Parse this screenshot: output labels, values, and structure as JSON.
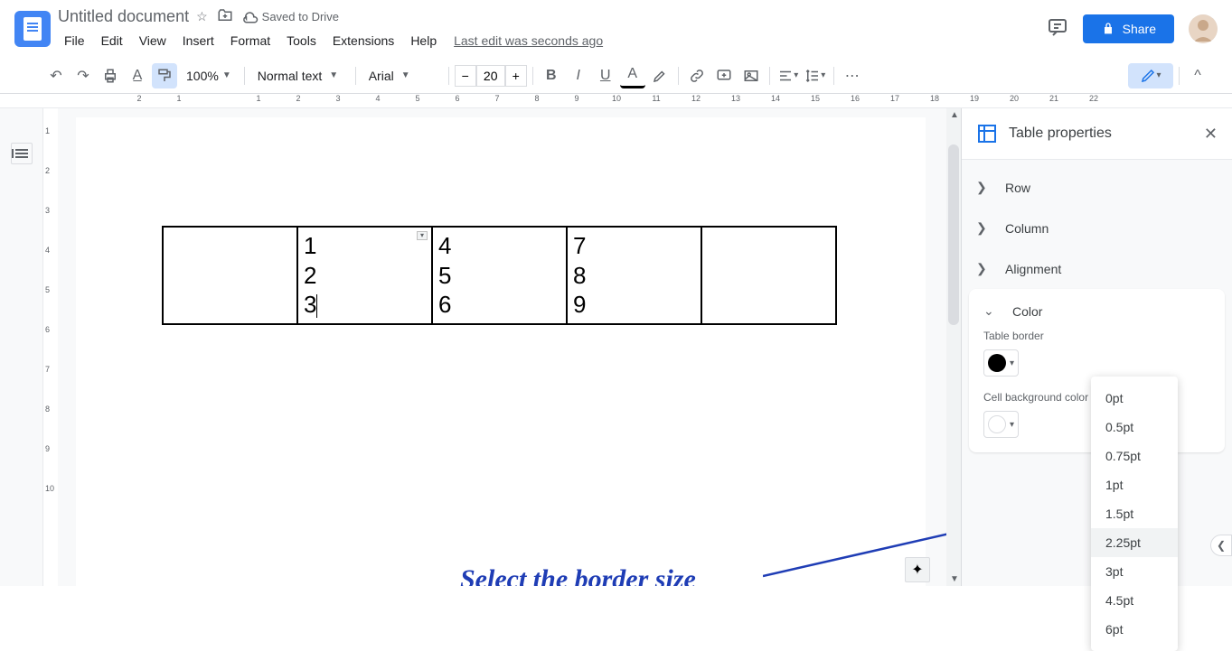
{
  "header": {
    "doc_title": "Untitled document",
    "saved_label": "Saved to Drive",
    "last_edit": "Last edit was seconds ago",
    "share_label": "Share"
  },
  "menus": [
    "File",
    "Edit",
    "View",
    "Insert",
    "Format",
    "Tools",
    "Extensions",
    "Help"
  ],
  "toolbar": {
    "zoom": "100%",
    "style": "Normal text",
    "font": "Arial",
    "font_size": "20"
  },
  "ruler_h": [
    "2",
    "1",
    "",
    "1",
    "2",
    "3",
    "4",
    "5",
    "6",
    "7",
    "8",
    "9",
    "10",
    "11",
    "12",
    "13",
    "14",
    "15",
    "16",
    "17",
    "18",
    "19",
    "20",
    "21",
    "22"
  ],
  "ruler_v": [
    "1",
    "2",
    "3",
    "4",
    "5",
    "6",
    "7",
    "8",
    "9",
    "10"
  ],
  "table": {
    "cells": [
      "",
      "1\n2\n3",
      "4\n5\n6",
      "7\n8\n9",
      ""
    ]
  },
  "annotation": "Select the border size",
  "sidepanel": {
    "title": "Table properties",
    "sections": {
      "row": "Row",
      "column": "Column",
      "alignment": "Alignment",
      "color": "Color"
    },
    "table_border_label": "Table border",
    "cell_bg_label": "Cell background color"
  },
  "border_sizes": [
    "0pt",
    "0.5pt",
    "0.75pt",
    "1pt",
    "1.5pt",
    "2.25pt",
    "3pt",
    "4.5pt",
    "6pt"
  ],
  "border_size_hover_index": 5
}
